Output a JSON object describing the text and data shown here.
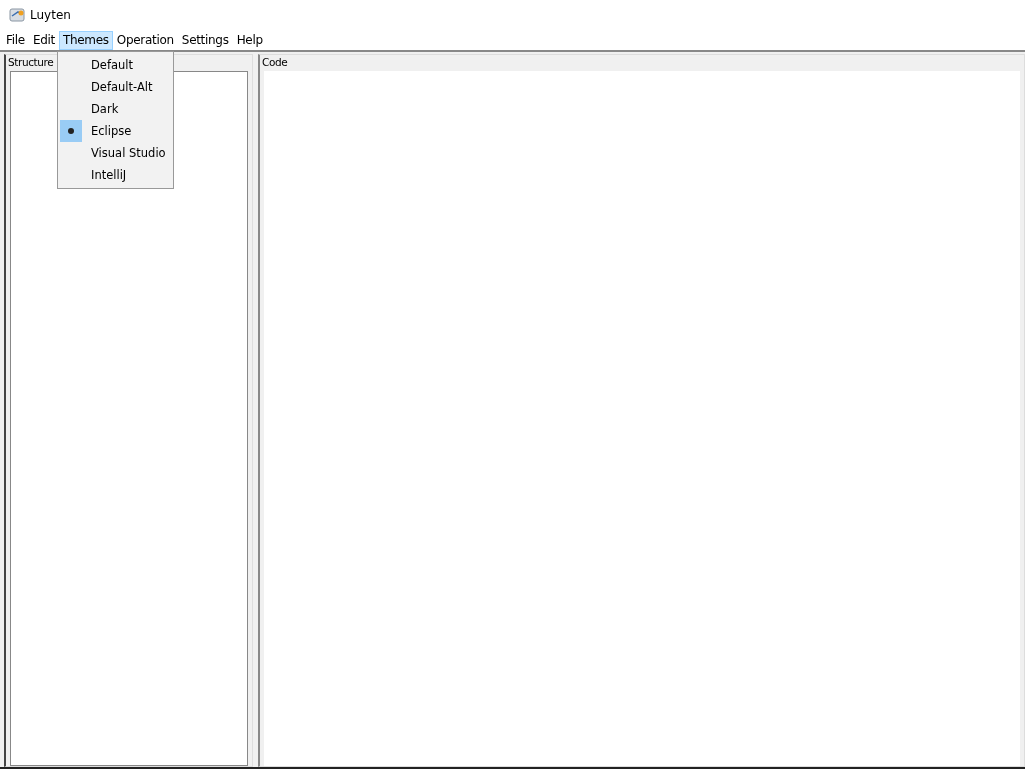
{
  "window": {
    "title": "Luyten"
  },
  "menu_bar": [
    {
      "label": "File",
      "selected": false
    },
    {
      "label": "Edit",
      "selected": false
    },
    {
      "label": "Themes",
      "selected": true
    },
    {
      "label": "Operation",
      "selected": false
    },
    {
      "label": "Settings",
      "selected": false
    },
    {
      "label": "Help",
      "selected": false
    }
  ],
  "themes_menu": [
    {
      "label": "Default",
      "selected": false
    },
    {
      "label": "Default-Alt",
      "selected": false
    },
    {
      "label": "Dark",
      "selected": false
    },
    {
      "label": "Eclipse",
      "selected": true
    },
    {
      "label": "Visual Studio",
      "selected": false
    },
    {
      "label": "IntelliJ",
      "selected": false
    }
  ],
  "structure_panel": {
    "title": "Structure"
  },
  "code_panel": {
    "title": "Code"
  }
}
